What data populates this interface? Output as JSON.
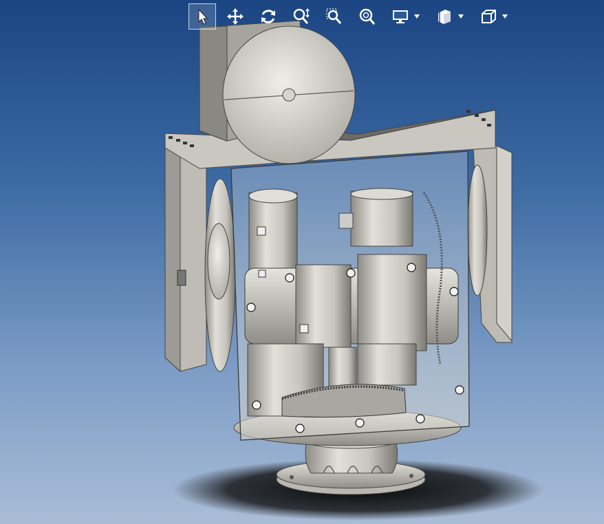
{
  "viewport": {
    "background_top": "#1b4582",
    "background_bottom": "#a9bdd7"
  },
  "toolbar": {
    "tools": [
      {
        "name": "select",
        "icon": "cursor-arrow-icon",
        "selected": true
      },
      {
        "name": "pan",
        "icon": "pan-arrows-icon"
      },
      {
        "name": "rotate",
        "icon": "rotate-icon"
      },
      {
        "name": "zoom",
        "icon": "zoom-updown-icon"
      },
      {
        "name": "zoom-window",
        "icon": "zoom-window-icon"
      },
      {
        "name": "zoom-fit",
        "icon": "zoom-fit-icon"
      },
      {
        "name": "display-mode",
        "icon": "monitor-icon",
        "dropdown": true
      },
      {
        "name": "section-view",
        "icon": "section-box-icon",
        "dropdown": true
      },
      {
        "name": "view-orientation",
        "icon": "cube-icon",
        "dropdown": true
      }
    ]
  },
  "model": {
    "description_icon": "pan-tilt-gearbox-assembly-icon",
    "body_color": "#c9c7bf",
    "shadow_color": "#1a1a1a"
  }
}
